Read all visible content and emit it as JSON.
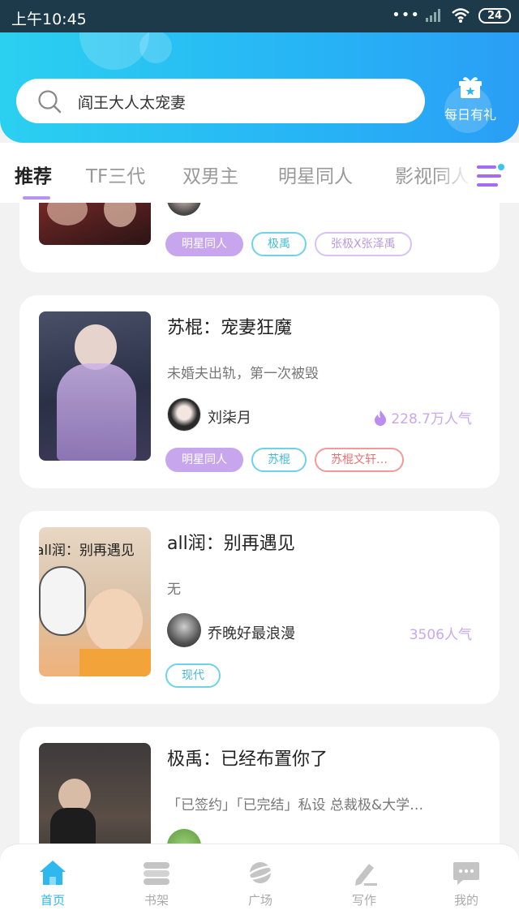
{
  "status_bar": {
    "time": "上午10:45",
    "battery": "24"
  },
  "header": {
    "search_text": "阎王大人太宠妻",
    "daily_gift_label": "每日有礼"
  },
  "tabs": [
    {
      "label": "推荐",
      "active": true
    },
    {
      "label": "TF三代",
      "active": false
    },
    {
      "label": "双男主",
      "active": false
    },
    {
      "label": "明星同人",
      "active": false
    },
    {
      "label": "影视同人",
      "active": false
    }
  ],
  "cards": [
    {
      "title": "",
      "description": "",
      "author": "",
      "popularity": "",
      "tags": [
        {
          "label": "明星同人",
          "style": "purple"
        },
        {
          "label": "极禹",
          "style": "cyan"
        },
        {
          "label": "张极X张泽禹",
          "style": "lilac"
        }
      ]
    },
    {
      "title": "苏棍：宠妻狂魔",
      "description": "未婚夫出轨，第一次被毁",
      "author": "刘柒月",
      "popularity": "228.7万人气",
      "show_flame": true,
      "tags": [
        {
          "label": "明星同人",
          "style": "purple"
        },
        {
          "label": "苏棍",
          "style": "cyan"
        },
        {
          "label": "苏棍文轩…",
          "style": "red"
        }
      ]
    },
    {
      "title": "all润：别再遇见",
      "description": "无",
      "author": "乔晚好最浪漫",
      "popularity": "3506人气",
      "cover_text": "all润：别再遇见",
      "tags": [
        {
          "label": "现代",
          "style": "cyan"
        }
      ]
    },
    {
      "title": "极禹：已经布置你了",
      "description": "「已签约」「已完结」私设 总裁极&大学…",
      "author": "",
      "popularity": "",
      "tags": []
    }
  ],
  "bottom_nav": [
    {
      "label": "首页",
      "icon": "home-icon",
      "active": true
    },
    {
      "label": "书架",
      "icon": "bookshelf-icon",
      "active": false
    },
    {
      "label": "广场",
      "icon": "planet-icon",
      "active": false
    },
    {
      "label": "写作",
      "icon": "pen-icon",
      "active": false
    },
    {
      "label": "我的",
      "icon": "chat-bubble-icon",
      "active": false
    }
  ],
  "colors": {
    "header_gradient_start": "#2bd0f0",
    "header_gradient_end": "#2a9ef5",
    "active_tab_underline": "#b794f4",
    "nav_active": "#2fb7ef",
    "popularity": "#c9a8ee"
  }
}
